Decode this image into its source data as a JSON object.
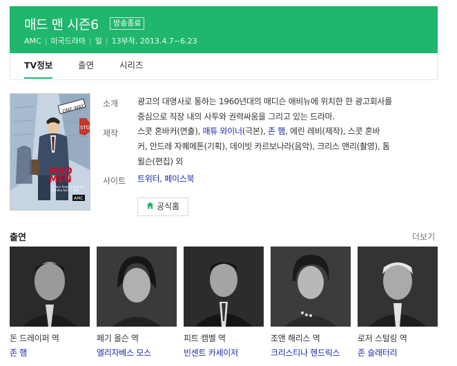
{
  "header": {
    "title": "매드 맨 시즌6",
    "badge": "방송종료",
    "meta": [
      "AMC",
      "미국드라마",
      "일",
      "13부작, 2013.4.7~6.23"
    ],
    "bg_color": "#20b66c"
  },
  "tabs": [
    {
      "label": "TV정보",
      "active": true
    },
    {
      "label": "출연",
      "active": false
    },
    {
      "label": "시리즈",
      "active": false
    }
  ],
  "poster": {
    "sign1": "ONE WAY",
    "sign2": "STOP",
    "logo_text1": "MAD",
    "logo_text2": "MEN",
    "tagline": "2 Hour Season Premiere",
    "tagline2": "Sunday April 7 9/8c",
    "network": "AMC"
  },
  "info": {
    "intro_label": "소개",
    "intro_text_1": "광고의 대명사로 통하는 1960년대의 매디슨 애비뉴에 위치한 한 광고회사를",
    "intro_text_2": "중심으로 직장 내의 사투와 권력싸움을 그리고 있는 드라마.",
    "production_label": "제작",
    "production_1": {
      "a": "스콧 혼바커",
      "b": "(연출), ",
      "c": "매튜 와이너",
      "d": "(극본), ",
      "e": "존 햄",
      "f": ", 에린 레비(제작), 스콧 혼바"
    },
    "production_2": "커, 안드레 자퀘메톤(기획), 데이빗 카르보나라(음악), 크리스 맨리(촬영), 톰",
    "production_3": "윌슨(편집) 외",
    "site_label": "사이트",
    "site_link1": "트위터",
    "site_sep": ", ",
    "site_link2": "페이스북",
    "homepage_button": "공식홈"
  },
  "cast_section": {
    "title": "출연",
    "more": "더보기",
    "members": [
      {
        "role": "돈 드레이퍼 역",
        "name": "존 햄"
      },
      {
        "role": "페기 올슨 역",
        "name": "엘리자베스 모스"
      },
      {
        "role": "피트 캠벨 역",
        "name": "빈센트 카세이저"
      },
      {
        "role": "조앤 해리스 역",
        "name": "크리스티나 헨드릭스"
      },
      {
        "role": "로저 스털링 역",
        "name": "존 슬래터리"
      }
    ]
  },
  "colors": {
    "link": "#1a2aa8",
    "accent": "#20b66c"
  }
}
